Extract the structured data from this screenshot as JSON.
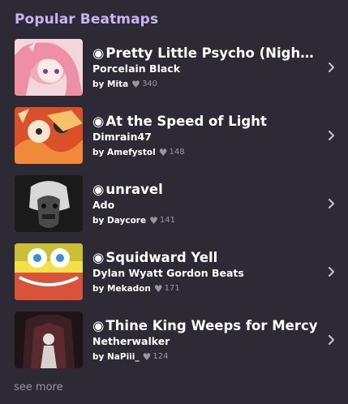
{
  "section": {
    "title": "Popular Beatmaps",
    "see_more_label": "see more"
  },
  "items": [
    {
      "title": "Pretty Little Psycho (Nightc...",
      "artist": "Porcelain Black",
      "by": "by Mita",
      "likes": "340"
    },
    {
      "title": "At the Speed of Light",
      "artist": "Dimrain47",
      "by": "by Amefystol",
      "likes": "148"
    },
    {
      "title": "unravel",
      "artist": "Ado",
      "by": "by Daycore",
      "likes": "141"
    },
    {
      "title": "Squidward Yell",
      "artist": "Dylan Wyatt Gordon Beats",
      "by": "by Mekadon",
      "likes": "171"
    },
    {
      "title": "Thine King Weeps for Mercy",
      "artist": "Netherwalker",
      "by": "by NaPiii_",
      "likes": "124"
    }
  ],
  "colors": {
    "background": "#2e2a35",
    "accent": "#c8b4f0",
    "muted": "#9a95a3"
  },
  "icons": {
    "record": "record-icon",
    "heart": "heart-icon",
    "chevron": "chevron-right-icon"
  }
}
